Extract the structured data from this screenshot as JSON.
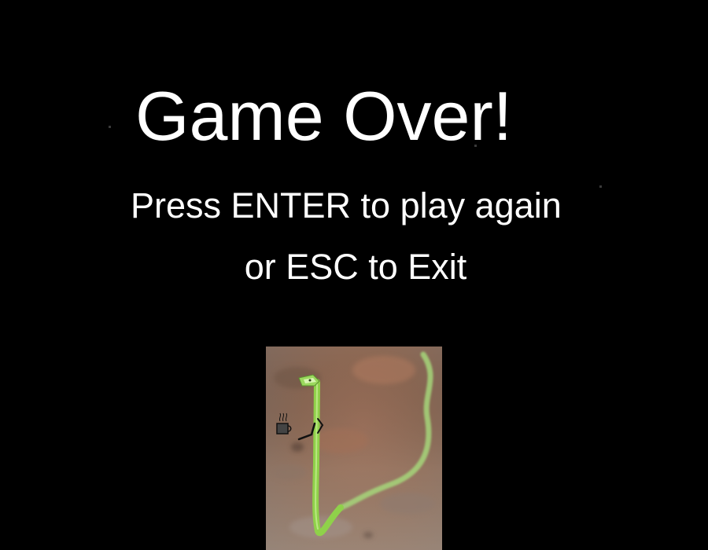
{
  "screen": {
    "title": "Game Over!",
    "prompt_line_1": "Press ENTER to play again",
    "prompt_line_2": "or ESC to Exit"
  },
  "image": {
    "subject": "snake-holding-coffee-mug"
  },
  "colors": {
    "background": "#000000",
    "text": "#ffffff",
    "snake": "#8fd14a",
    "ground": "#9a7a64"
  }
}
